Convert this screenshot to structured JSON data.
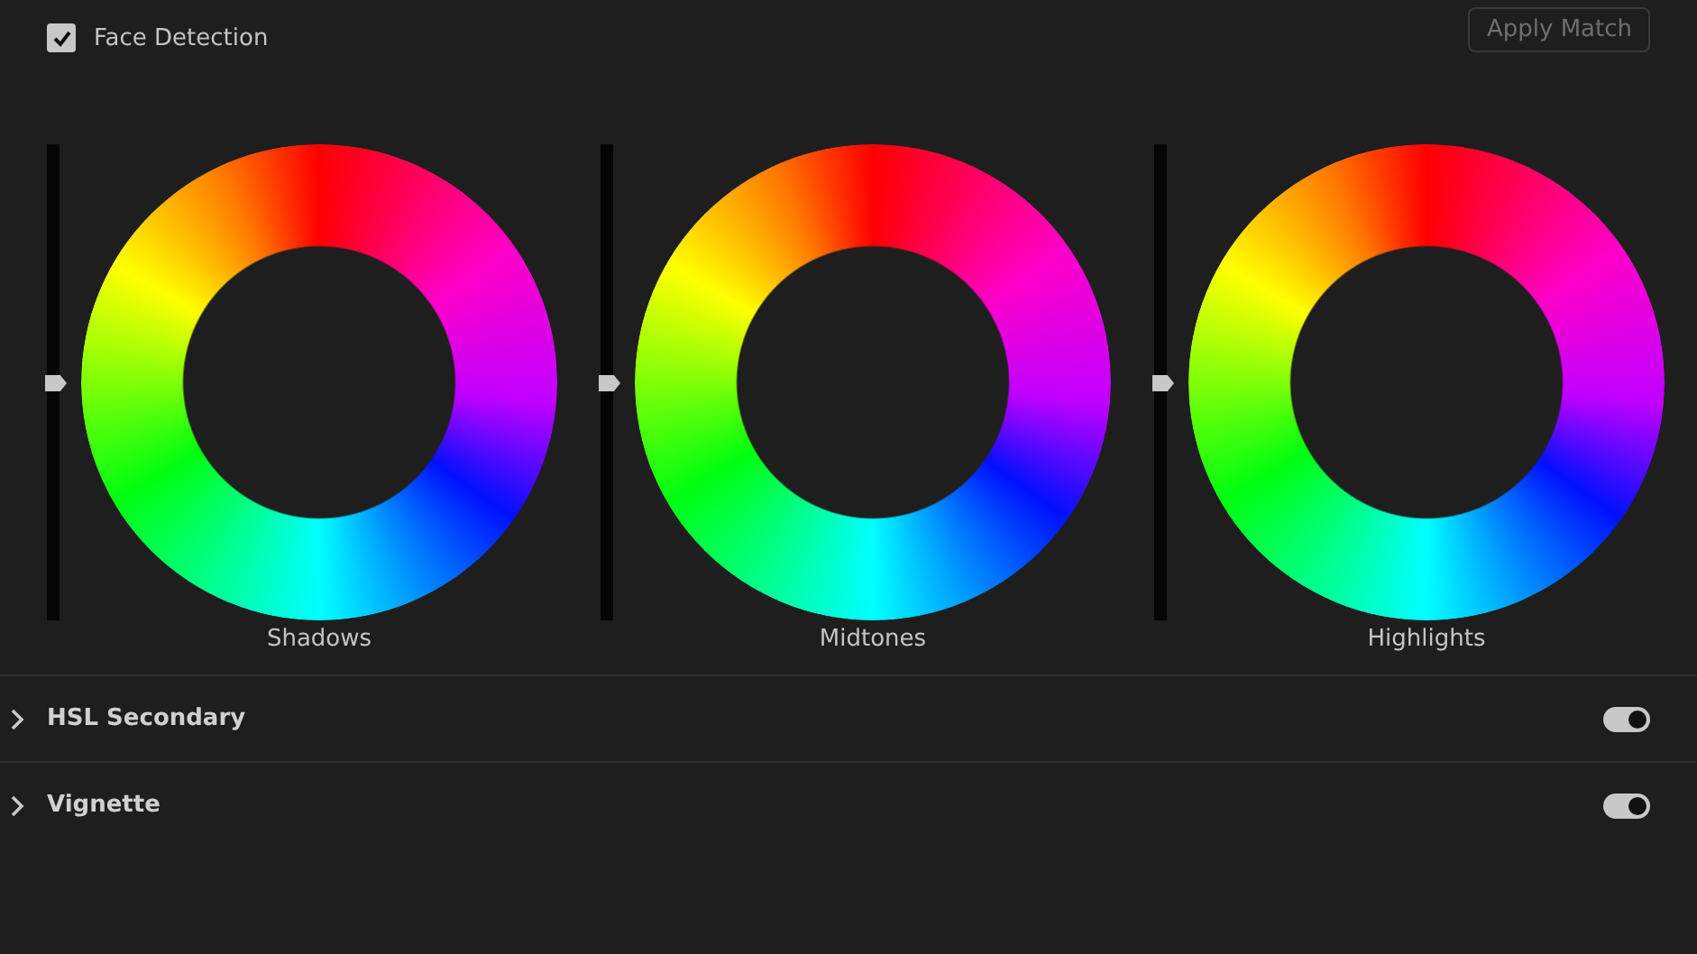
{
  "face_detection": {
    "label": "Face Detection",
    "checked": true
  },
  "apply_match_button": {
    "label": "Apply Match",
    "disabled": true
  },
  "wheels": [
    {
      "label": "Shadows",
      "level": 0.5
    },
    {
      "label": "Midtones",
      "level": 0.5
    },
    {
      "label": "Highlights",
      "level": 0.5
    }
  ],
  "sections": [
    {
      "title": "HSL Secondary",
      "expanded": false,
      "on": true
    },
    {
      "title": "Vignette",
      "expanded": false,
      "on": true
    }
  ]
}
